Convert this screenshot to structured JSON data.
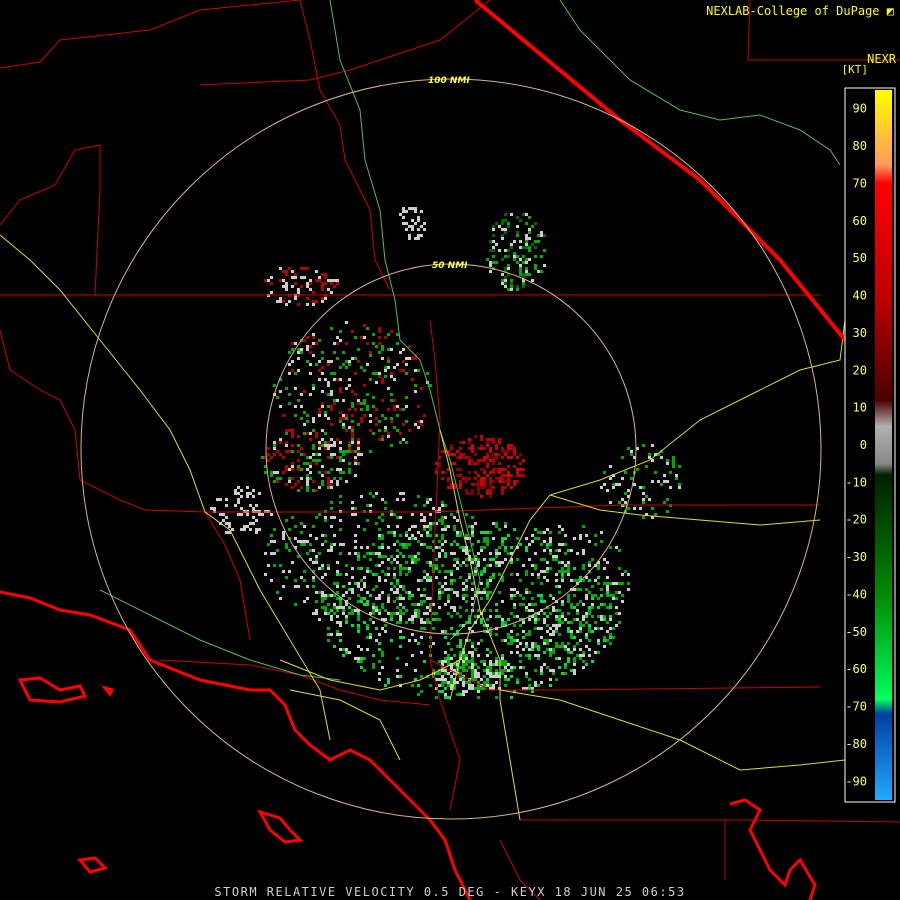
{
  "header": {
    "credit": "NEXLAB-College of DuPage",
    "product_code": "NEXR"
  },
  "footer": {
    "caption": "STORM RELATIVE VELOCITY 0.5 DEG - KEYX 18 JUN 25 06:53"
  },
  "range_rings": [
    {
      "label": "100 NMI"
    },
    {
      "label": "50 NMI"
    }
  ],
  "colorbar": {
    "unit": "[KT]",
    "min": -95,
    "max": 95,
    "ticks": [
      "90",
      "80",
      "70",
      "60",
      "50",
      "40",
      "30",
      "20",
      "10",
      "0",
      "-10",
      "-20",
      "-30",
      "-40",
      "-50",
      "-60",
      "-70",
      "-80",
      "-90"
    ],
    "tick_values": [
      90,
      80,
      70,
      60,
      50,
      40,
      30,
      20,
      10,
      0,
      -10,
      -20,
      -30,
      -40,
      -50,
      -60,
      -70,
      -80,
      -90
    ],
    "gradient_stops": [
      {
        "value": 95,
        "color": "#ffff00"
      },
      {
        "value": 75,
        "color": "#ff9a5a"
      },
      {
        "value": 70,
        "color": "#ff0000"
      },
      {
        "value": 40,
        "color": "#c00000"
      },
      {
        "value": 12,
        "color": "#4a0000"
      },
      {
        "value": 5,
        "color": "#b0b0b0"
      },
      {
        "value": -5,
        "color": "#888888"
      },
      {
        "value": -8,
        "color": "#002000"
      },
      {
        "value": -40,
        "color": "#008a00"
      },
      {
        "value": -68,
        "color": "#00ff60"
      },
      {
        "value": -72,
        "color": "#0040a0"
      },
      {
        "value": -95,
        "color": "#22aaff"
      }
    ]
  },
  "colors": {
    "state_border": "#cc0000",
    "coastline": "#ff0000",
    "highway": "#dddd33",
    "river": "#55bb55",
    "range_ring": "#d8b48a",
    "inbound": "#00aa00",
    "outbound": "#b00000",
    "near_zero": "#cccccc"
  }
}
